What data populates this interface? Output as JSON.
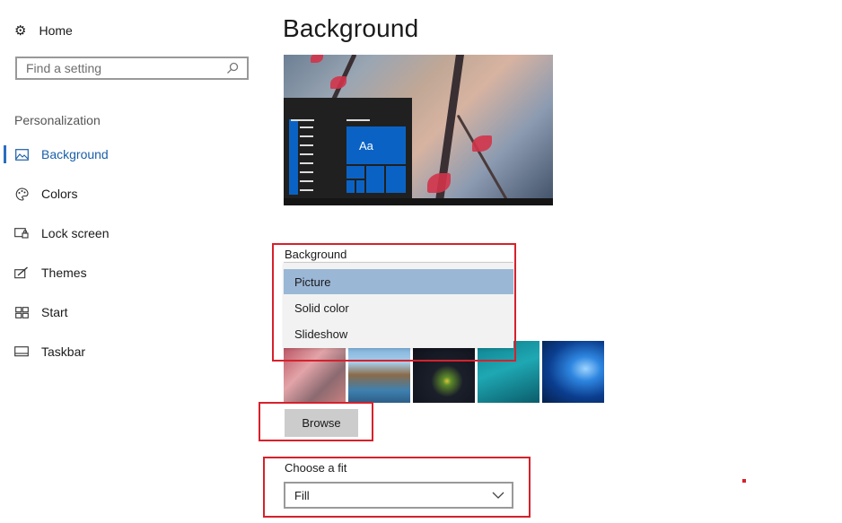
{
  "sidebar": {
    "home_label": "Home",
    "search_placeholder": "Find a setting",
    "section_label": "Personalization",
    "items": [
      {
        "label": "Background",
        "icon": "picture-icon",
        "active": true
      },
      {
        "label": "Colors",
        "icon": "palette-icon"
      },
      {
        "label": "Lock screen",
        "icon": "lock-screen-icon"
      },
      {
        "label": "Themes",
        "icon": "themes-icon"
      },
      {
        "label": "Start",
        "icon": "start-icon"
      },
      {
        "label": "Taskbar",
        "icon": "taskbar-icon"
      }
    ]
  },
  "main": {
    "title": "Background",
    "preview": {
      "tile_text": "Aa"
    },
    "background_label": "Background",
    "background_options": [
      "Picture",
      "Solid color",
      "Slideshow"
    ],
    "background_selected": "Picture",
    "browse_label": "Browse",
    "fit_label": "Choose a fit",
    "fit_value": "Fill"
  },
  "colors": {
    "accent": "#0a63c4",
    "selection": "#9bb7d6",
    "annotation": "#d6212c"
  }
}
